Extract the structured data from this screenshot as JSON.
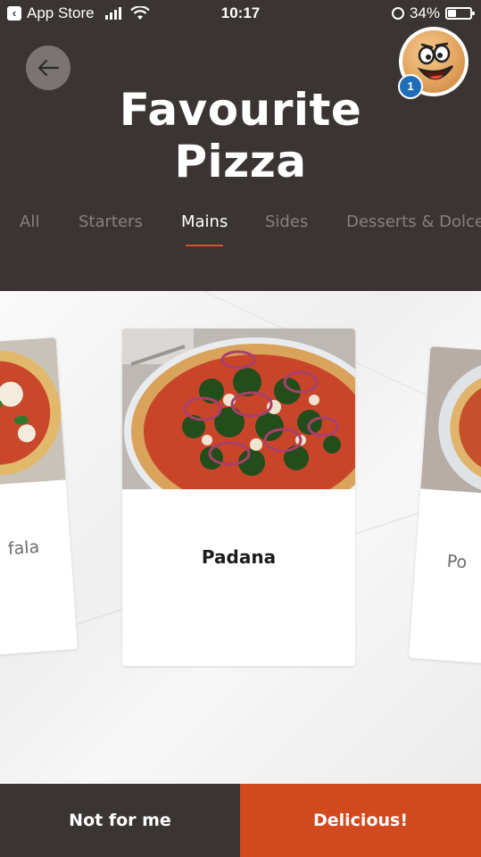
{
  "status_bar": {
    "back_app": "App Store",
    "time": "10:17",
    "battery": "34%",
    "battery_level": 0.34
  },
  "header": {
    "title_line1": "Favourite",
    "title_line2": "Pizza",
    "avatar_badge": "1"
  },
  "tabs": [
    {
      "label": "All",
      "active": false
    },
    {
      "label": "Starters",
      "active": false
    },
    {
      "label": "Mains",
      "active": true
    },
    {
      "label": "Sides",
      "active": false
    },
    {
      "label": "Desserts & Dolce",
      "active": false
    }
  ],
  "cards": {
    "left_partial": "fala",
    "main": "Padana",
    "right_partial": "Po"
  },
  "actions": {
    "reject": "Not for me",
    "accept": "Delicious!"
  },
  "colors": {
    "header_bg": "#3a3533",
    "accent": "#d2491e",
    "badge": "#1f6fb8"
  }
}
